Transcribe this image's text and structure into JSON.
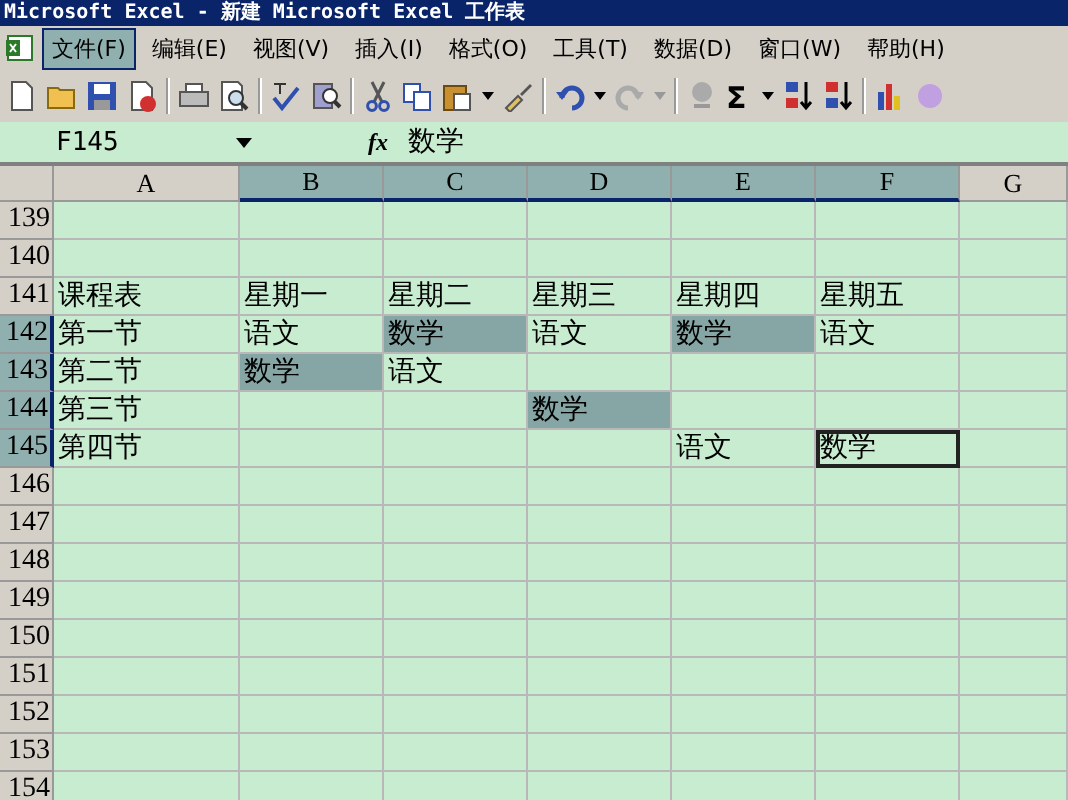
{
  "window": {
    "title": "Microsoft Excel - 新建 Microsoft Excel 工作表"
  },
  "menu": [
    {
      "label": "文件(F)",
      "selected": true
    },
    {
      "label": "编辑(E)",
      "selected": false
    },
    {
      "label": "视图(V)",
      "selected": false
    },
    {
      "label": "插入(I)",
      "selected": false
    },
    {
      "label": "格式(O)",
      "selected": false
    },
    {
      "label": "工具(T)",
      "selected": false
    },
    {
      "label": "数据(D)",
      "selected": false
    },
    {
      "label": "窗口(W)",
      "selected": false
    },
    {
      "label": "帮助(H)",
      "selected": false
    }
  ],
  "toolbar": {
    "sum": "Σ"
  },
  "formula_bar": {
    "name_box": "F145",
    "function_label": "fx",
    "value": "数学"
  },
  "sheet": {
    "columns": [
      {
        "label": "A",
        "selected": false
      },
      {
        "label": "B",
        "selected": true
      },
      {
        "label": "C",
        "selected": true
      },
      {
        "label": "D",
        "selected": true
      },
      {
        "label": "E",
        "selected": true
      },
      {
        "label": "F",
        "selected": true
      },
      {
        "label": "G",
        "selected": false
      }
    ],
    "rows": [
      {
        "number": "139",
        "selected": false
      },
      {
        "number": "140",
        "selected": false
      },
      {
        "number": "141",
        "selected": false,
        "cells": [
          {
            "text": "课程表",
            "highlighted": false,
            "selected": false
          },
          {
            "text": "星期一",
            "highlighted": false,
            "selected": false
          },
          {
            "text": "星期二",
            "highlighted": false,
            "selected": false
          },
          {
            "text": "星期三",
            "highlighted": false,
            "selected": false
          },
          {
            "text": "星期四",
            "highlighted": false,
            "selected": false
          },
          {
            "text": "星期五",
            "highlighted": false,
            "selected": false
          },
          {
            "highlighted": false,
            "selected": false
          }
        ]
      },
      {
        "number": "142",
        "selected": true,
        "cells": [
          {
            "text": "第一节",
            "highlighted": false,
            "selected": false
          },
          {
            "text": "语文",
            "highlighted": false,
            "selected": false
          },
          {
            "text": "数学",
            "highlighted": true,
            "selected": false
          },
          {
            "text": "语文",
            "highlighted": false,
            "selected": false
          },
          {
            "text": "数学",
            "highlighted": true,
            "selected": false
          },
          {
            "text": "语文",
            "highlighted": false,
            "selected": false
          },
          {
            "highlighted": false,
            "selected": false
          }
        ]
      },
      {
        "number": "143",
        "selected": true,
        "cells": [
          {
            "text": "第二节",
            "highlighted": false,
            "selected": false
          },
          {
            "text": "数学",
            "highlighted": true,
            "selected": false
          },
          {
            "text": "语文",
            "highlighted": false,
            "selected": false
          },
          {
            "highlighted": false,
            "selected": false
          },
          {
            "highlighted": false,
            "selected": false
          },
          {
            "highlighted": false,
            "selected": false
          },
          {
            "highlighted": false,
            "selected": false
          }
        ]
      },
      {
        "number": "144",
        "selected": true,
        "cells": [
          {
            "text": "第三节",
            "highlighted": false,
            "selected": false
          },
          {
            "highlighted": false,
            "selected": false
          },
          {
            "highlighted": false,
            "selected": false
          },
          {
            "text": "数学",
            "highlighted": true,
            "selected": false
          },
          {
            "highlighted": false,
            "selected": false
          },
          {
            "highlighted": false,
            "selected": false
          },
          {
            "highlighted": false,
            "selected": false
          }
        ]
      },
      {
        "number": "145",
        "selected": true,
        "cells": [
          {
            "text": "第四节",
            "highlighted": false,
            "selected": false
          },
          {
            "highlighted": false,
            "selected": false
          },
          {
            "highlighted": false,
            "selected": false
          },
          {
            "highlighted": false,
            "selected": false
          },
          {
            "text": "语文",
            "highlighted": false,
            "selected": false
          },
          {
            "text": "数学",
            "highlighted": false,
            "selected": true
          },
          {
            "highlighted": false,
            "selected": false
          }
        ]
      },
      {
        "number": "146",
        "selected": false
      },
      {
        "number": "147",
        "selected": false
      },
      {
        "number": "148",
        "selected": false
      },
      {
        "number": "149",
        "selected": false
      },
      {
        "number": "150",
        "selected": false
      },
      {
        "number": "151",
        "selected": false
      },
      {
        "number": "152",
        "selected": false
      },
      {
        "number": "153",
        "selected": false
      },
      {
        "number": "154",
        "selected": false
      }
    ]
  }
}
